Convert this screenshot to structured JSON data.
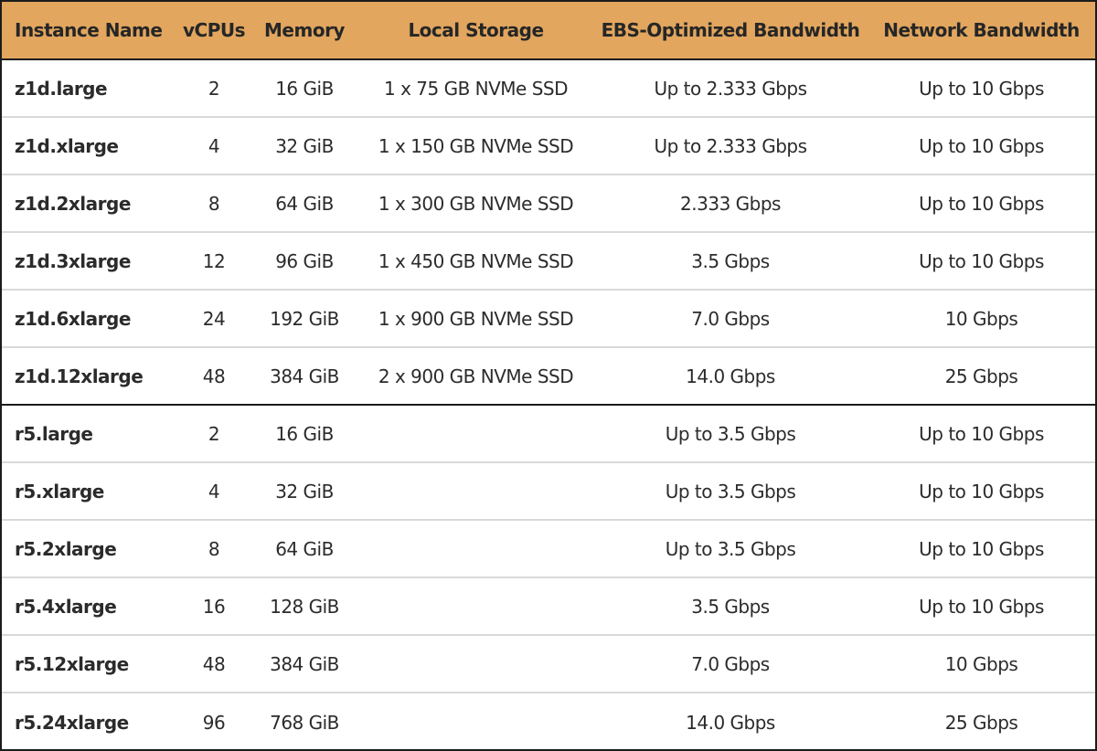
{
  "table": {
    "header_color": "#e2a65e",
    "columns": [
      "Instance Name",
      "vCPUs",
      "Memory",
      "Local Storage",
      "EBS-Optimized Bandwidth",
      "Network Bandwidth"
    ],
    "rows": [
      [
        "z1d.large",
        "2",
        "16 GiB",
        "1 x 75 GB NVMe SSD",
        "Up to 2.333 Gbps",
        "Up to 10 Gbps"
      ],
      [
        "z1d.xlarge",
        "4",
        "32 GiB",
        "1 x 150 GB NVMe SSD",
        "Up to 2.333 Gbps",
        "Up to 10 Gbps"
      ],
      [
        "z1d.2xlarge",
        "8",
        "64 GiB",
        "1 x 300 GB NVMe SSD",
        "2.333 Gbps",
        "Up to 10 Gbps"
      ],
      [
        "z1d.3xlarge",
        "12",
        "96 GiB",
        "1 x 450 GB NVMe SSD",
        "3.5 Gbps",
        "Up to 10 Gbps"
      ],
      [
        "z1d.6xlarge",
        "24",
        "192 GiB",
        "1 x 900 GB NVMe SSD",
        "7.0 Gbps",
        "10 Gbps"
      ],
      [
        "z1d.12xlarge",
        "48",
        "384 GiB",
        "2 x 900 GB NVMe SSD",
        "14.0 Gbps",
        "25 Gbps"
      ],
      [
        "r5.large",
        "2",
        "16 GiB",
        "",
        "Up to 3.5 Gbps",
        "Up to 10 Gbps"
      ],
      [
        "r5.xlarge",
        "4",
        "32 GiB",
        "",
        "Up to 3.5 Gbps",
        "Up to 10 Gbps"
      ],
      [
        "r5.2xlarge",
        "8",
        "64 GiB",
        "",
        "Up to 3.5 Gbps",
        "Up to 10 Gbps"
      ],
      [
        "r5.4xlarge",
        "16",
        "128 GiB",
        "",
        "3.5 Gbps",
        "Up to 10 Gbps"
      ],
      [
        "r5.12xlarge",
        "48",
        "384 GiB",
        "",
        "7.0 Gbps",
        "10 Gbps"
      ],
      [
        "r5.24xlarge",
        "96",
        "768 GiB",
        "",
        "14.0 Gbps",
        "25 Gbps"
      ]
    ]
  }
}
